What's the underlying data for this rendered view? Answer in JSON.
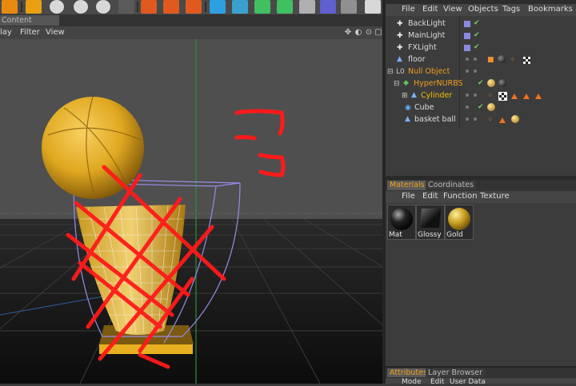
{
  "viewport": {
    "tab_label": "Content Browser",
    "menu": [
      "lay",
      "Filter",
      "View"
    ],
    "nav_icons": [
      "move-icon",
      "rotate-icon",
      "zoom-icon",
      "maximize-icon"
    ]
  },
  "toolbar": {
    "icons": [
      "refresh-icon",
      "x-axis-icon",
      "y-axis-icon",
      "z-axis-icon",
      "world-icon",
      "clapper-icon",
      "render-icon",
      "render-settings-icon",
      "cube-icon",
      "spline-icon",
      "nurbs-icon",
      "array-icon",
      "deformer-icon",
      "scene-icon",
      "light-icon",
      "camera-icon",
      "pointer-icon"
    ]
  },
  "objects_panel": {
    "menu": [
      "File",
      "Edit",
      "View",
      "Objects",
      "Tags",
      "Bookmarks"
    ],
    "items": [
      {
        "label": "BackLight",
        "color": "#e8e8e8"
      },
      {
        "label": "MainLight",
        "color": "#e8e8e8"
      },
      {
        "label": "FXLight",
        "color": "#e8e8e8"
      },
      {
        "label": "floor",
        "color": "#e8e8e8"
      },
      {
        "label": "Null Object",
        "color": "#f0a020"
      },
      {
        "label": "HyperNURBS",
        "color": "#f0a020"
      },
      {
        "label": "Cylinder",
        "color": "#f0c000"
      },
      {
        "label": "Cube",
        "color": "#e8e8e8"
      },
      {
        "label": "basket ball",
        "color": "#e8e8e8"
      }
    ]
  },
  "materials_panel": {
    "tabs": [
      "Materials",
      "Coordinates"
    ],
    "menu": [
      "File",
      "Edit",
      "Function",
      "Texture"
    ],
    "materials": [
      {
        "label": "Mat",
        "color": "#111111"
      },
      {
        "label": "Glossy",
        "color": "#222222"
      },
      {
        "label": "Gold",
        "color": "#c9a020"
      }
    ]
  },
  "attributes_panel": {
    "tabs": [
      "Attributes",
      "Layer Browser"
    ],
    "menu": [
      "Mode",
      "Edit",
      "User Data"
    ]
  },
  "colors": {
    "accent_orange": "#f0a020",
    "check_green": "#6fd06f",
    "annotation_red": "#ff1a1a",
    "ball_gold": "#e0a820"
  }
}
